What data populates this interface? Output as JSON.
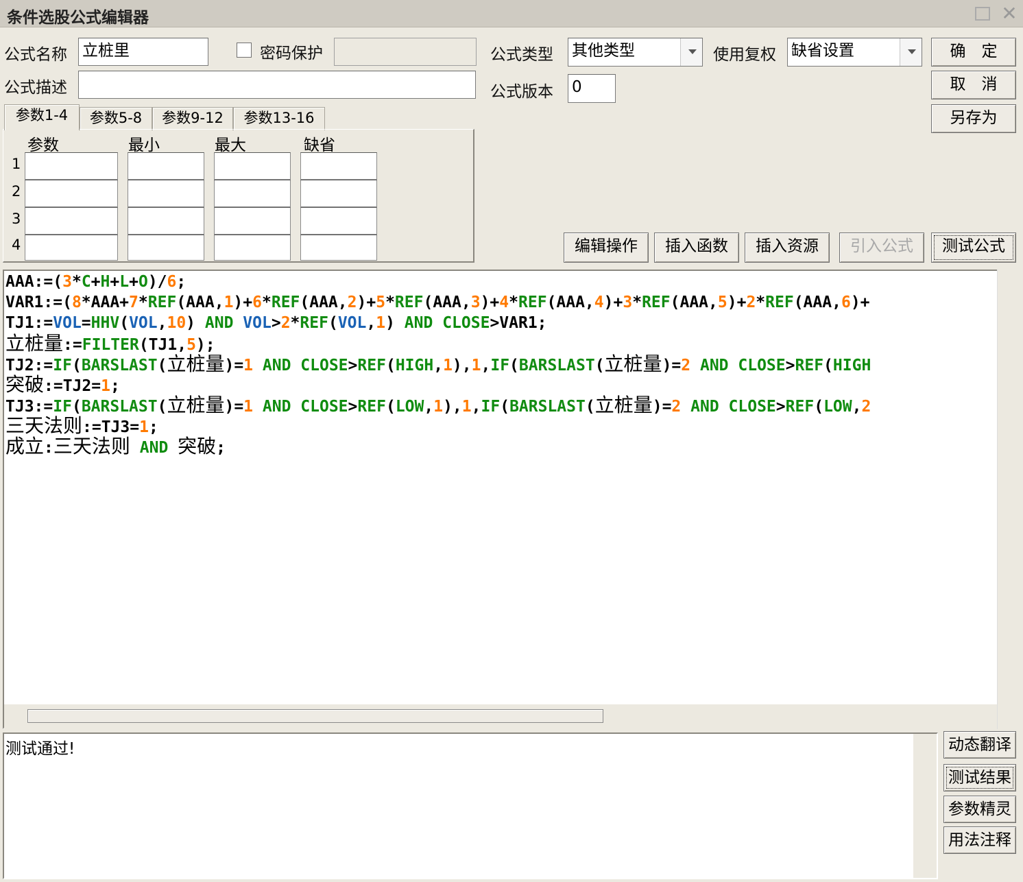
{
  "window": {
    "title": "条件选股公式编辑器"
  },
  "form": {
    "name_label": "公式名称",
    "name_value": "立桩里",
    "password_label": "密码保护",
    "password_value": "",
    "desc_label": "公式描述",
    "desc_value": "",
    "type_label": "公式类型",
    "type_value": "其他类型",
    "restore_label": "使用复权",
    "restore_value": "缺省设置",
    "version_label": "公式版本",
    "version_value": "0"
  },
  "buttons": {
    "ok": "确　定",
    "cancel": "取　消",
    "save_as": "另存为",
    "edit_ops": "编辑操作",
    "insert_func": "插入函数",
    "insert_res": "插入资源",
    "import_formula": "引入公式",
    "test_formula": "测试公式",
    "dynamic_translate": "动态翻译",
    "test_result": "测试结果",
    "param_wizard": "参数精灵",
    "usage_notes": "用法注释"
  },
  "tabs": [
    "参数1-4",
    "参数5-8",
    "参数9-12",
    "参数13-16"
  ],
  "param_table": {
    "headers": [
      "参数",
      "最小",
      "最大",
      "缺省"
    ],
    "rows": [
      "1",
      "2",
      "3",
      "4"
    ]
  },
  "code_lines": [
    [
      [
        "op",
        "AAA:=("
      ],
      [
        "num",
        "3"
      ],
      [
        "op",
        "*"
      ],
      [
        "fn",
        "C"
      ],
      [
        "op",
        "+"
      ],
      [
        "fn",
        "H"
      ],
      [
        "op",
        "+"
      ],
      [
        "fn",
        "L"
      ],
      [
        "op",
        "+"
      ],
      [
        "fn",
        "O"
      ],
      [
        "op",
        ")/"
      ],
      [
        "num",
        "6"
      ],
      [
        "op",
        ";"
      ]
    ],
    [
      [
        "op",
        "VAR1:=("
      ],
      [
        "num",
        "8"
      ],
      [
        "op",
        "*AAA+"
      ],
      [
        "num",
        "7"
      ],
      [
        "op",
        "*"
      ],
      [
        "fn",
        "REF"
      ],
      [
        "op",
        "(AAA,"
      ],
      [
        "num",
        "1"
      ],
      [
        "op",
        ")+"
      ],
      [
        "num",
        "6"
      ],
      [
        "op",
        "*"
      ],
      [
        "fn",
        "REF"
      ],
      [
        "op",
        "(AAA,"
      ],
      [
        "num",
        "2"
      ],
      [
        "op",
        ")+"
      ],
      [
        "num",
        "5"
      ],
      [
        "op",
        "*"
      ],
      [
        "fn",
        "REF"
      ],
      [
        "op",
        "(AAA,"
      ],
      [
        "num",
        "3"
      ],
      [
        "op",
        ")+"
      ],
      [
        "num",
        "4"
      ],
      [
        "op",
        "*"
      ],
      [
        "fn",
        "REF"
      ],
      [
        "op",
        "(AAA,"
      ],
      [
        "num",
        "4"
      ],
      [
        "op",
        ")+"
      ],
      [
        "num",
        "3"
      ],
      [
        "op",
        "*"
      ],
      [
        "fn",
        "REF"
      ],
      [
        "op",
        "(AAA,"
      ],
      [
        "num",
        "5"
      ],
      [
        "op",
        ")+"
      ],
      [
        "num",
        "2"
      ],
      [
        "op",
        "*"
      ],
      [
        "fn",
        "REF"
      ],
      [
        "op",
        "(AAA,"
      ],
      [
        "num",
        "6"
      ],
      [
        "op",
        ")+"
      ]
    ],
    [
      [
        "op",
        "TJ1:="
      ],
      [
        "var",
        "VOL"
      ],
      [
        "op",
        "="
      ],
      [
        "fn",
        "HHV"
      ],
      [
        "op",
        "("
      ],
      [
        "var",
        "VOL"
      ],
      [
        "op",
        ","
      ],
      [
        "num",
        "10"
      ],
      [
        "op",
        ") "
      ],
      [
        "kw",
        "AND"
      ],
      [
        "op",
        " "
      ],
      [
        "var",
        "VOL"
      ],
      [
        "op",
        ">"
      ],
      [
        "num",
        "2"
      ],
      [
        "op",
        "*"
      ],
      [
        "fn",
        "REF"
      ],
      [
        "op",
        "("
      ],
      [
        "var",
        "VOL"
      ],
      [
        "op",
        ","
      ],
      [
        "num",
        "1"
      ],
      [
        "op",
        ") "
      ],
      [
        "kw",
        "AND"
      ],
      [
        "op",
        " "
      ],
      [
        "kw",
        "CLOSE"
      ],
      [
        "op",
        ">VAR1;"
      ]
    ],
    [
      [
        "cn",
        "立桩量"
      ],
      [
        "op",
        ":="
      ],
      [
        "fn",
        "FILTER"
      ],
      [
        "op",
        "(TJ1,"
      ],
      [
        "num",
        "5"
      ],
      [
        "op",
        ");"
      ]
    ],
    [
      [
        "op",
        "TJ2:="
      ],
      [
        "fn",
        "IF"
      ],
      [
        "op",
        "("
      ],
      [
        "fn",
        "BARSLAST"
      ],
      [
        "op",
        "("
      ],
      [
        "cn",
        "立桩量"
      ],
      [
        "op",
        ")="
      ],
      [
        "num",
        "1"
      ],
      [
        "op",
        " "
      ],
      [
        "kw",
        "AND"
      ],
      [
        "op",
        " "
      ],
      [
        "kw",
        "CLOSE"
      ],
      [
        "op",
        ">"
      ],
      [
        "fn",
        "REF"
      ],
      [
        "op",
        "("
      ],
      [
        "kw",
        "HIGH"
      ],
      [
        "op",
        ","
      ],
      [
        "num",
        "1"
      ],
      [
        "op",
        "),"
      ],
      [
        "num",
        "1"
      ],
      [
        "op",
        ","
      ],
      [
        "fn",
        "IF"
      ],
      [
        "op",
        "("
      ],
      [
        "fn",
        "BARSLAST"
      ],
      [
        "op",
        "("
      ],
      [
        "cn",
        "立桩量"
      ],
      [
        "op",
        ")="
      ],
      [
        "num",
        "2"
      ],
      [
        "op",
        " "
      ],
      [
        "kw",
        "AND"
      ],
      [
        "op",
        " "
      ],
      [
        "kw",
        "CLOSE"
      ],
      [
        "op",
        ">"
      ],
      [
        "fn",
        "REF"
      ],
      [
        "op",
        "("
      ],
      [
        "kw",
        "HIGH"
      ]
    ],
    [
      [
        "cn",
        "突破"
      ],
      [
        "op",
        ":=TJ2="
      ],
      [
        "num",
        "1"
      ],
      [
        "op",
        ";"
      ]
    ],
    [
      [
        "op",
        "TJ3:="
      ],
      [
        "fn",
        "IF"
      ],
      [
        "op",
        "("
      ],
      [
        "fn",
        "BARSLAST"
      ],
      [
        "op",
        "("
      ],
      [
        "cn",
        "立桩量"
      ],
      [
        "op",
        ")="
      ],
      [
        "num",
        "1"
      ],
      [
        "op",
        " "
      ],
      [
        "kw",
        "AND"
      ],
      [
        "op",
        " "
      ],
      [
        "kw",
        "CLOSE"
      ],
      [
        "op",
        ">"
      ],
      [
        "fn",
        "REF"
      ],
      [
        "op",
        "("
      ],
      [
        "kw",
        "LOW"
      ],
      [
        "op",
        ","
      ],
      [
        "num",
        "1"
      ],
      [
        "op",
        "),"
      ],
      [
        "num",
        "1"
      ],
      [
        "op",
        ","
      ],
      [
        "fn",
        "IF"
      ],
      [
        "op",
        "("
      ],
      [
        "fn",
        "BARSLAST"
      ],
      [
        "op",
        "("
      ],
      [
        "cn",
        "立桩量"
      ],
      [
        "op",
        ")="
      ],
      [
        "num",
        "2"
      ],
      [
        "op",
        " "
      ],
      [
        "kw",
        "AND"
      ],
      [
        "op",
        " "
      ],
      [
        "kw",
        "CLOSE"
      ],
      [
        "op",
        ">"
      ],
      [
        "fn",
        "REF"
      ],
      [
        "op",
        "("
      ],
      [
        "kw",
        "LOW"
      ],
      [
        "op",
        ","
      ],
      [
        "num",
        "2"
      ]
    ],
    [
      [
        "cn",
        "三天法则"
      ],
      [
        "op",
        ":=TJ3="
      ],
      [
        "num",
        "1"
      ],
      [
        "op",
        ";"
      ]
    ],
    [
      [
        "cn",
        "成立"
      ],
      [
        "op",
        ":"
      ],
      [
        "cn",
        "三天法则"
      ],
      [
        "op",
        " "
      ],
      [
        "kw",
        "AND"
      ],
      [
        "op",
        " "
      ],
      [
        "cn",
        "突破"
      ],
      [
        "op",
        ";"
      ]
    ]
  ],
  "output": {
    "text": "测试通过!"
  },
  "colors": {
    "number": "#ff7a00",
    "function": "#128c12",
    "variable": "#1a62b5",
    "background": "#ece9e0"
  }
}
